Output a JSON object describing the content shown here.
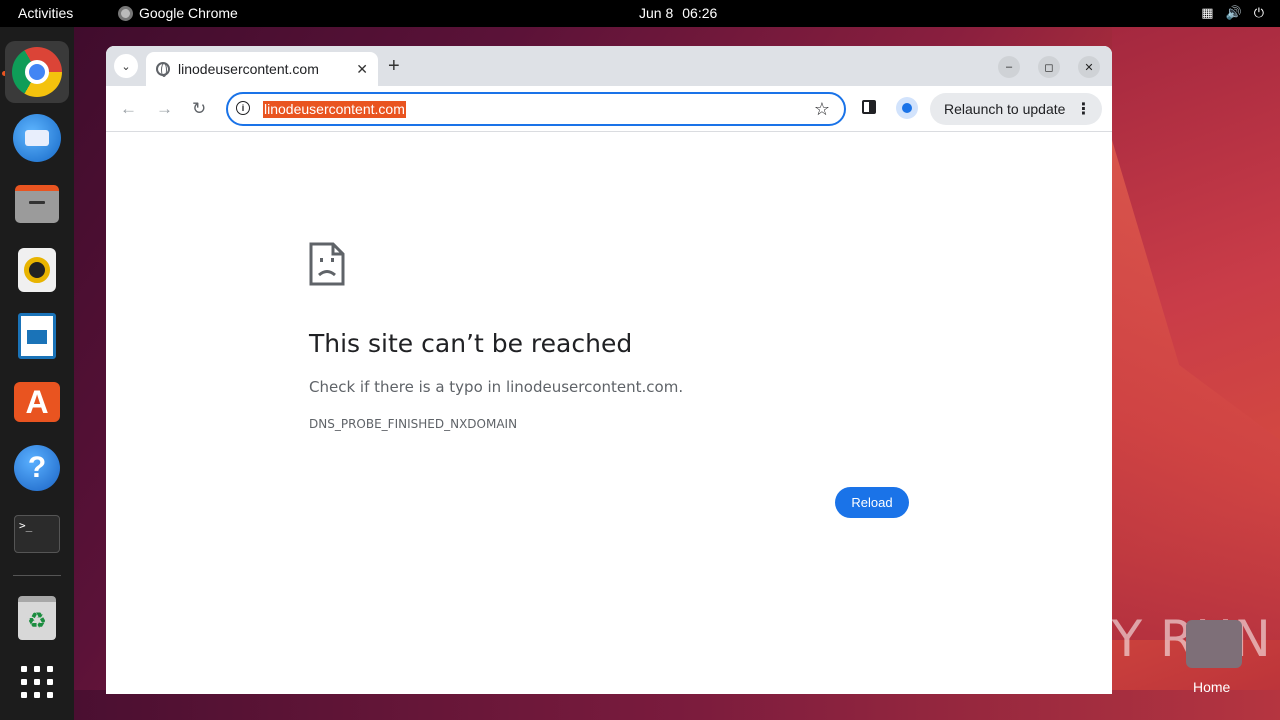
{
  "topbar": {
    "activities": "Activities",
    "app_name": "Google Chrome",
    "date": "Jun 8",
    "time": "06:26"
  },
  "dock": {
    "items": [
      "chrome",
      "thunderbird",
      "files",
      "rhythmbox",
      "writer",
      "app-center",
      "help",
      "terminal",
      "trash",
      "show-apps"
    ]
  },
  "browser": {
    "tab_title": "linodeusercontent.com",
    "url": "linodeusercontent.com",
    "relaunch_label": "Relaunch to update"
  },
  "error_page": {
    "title": "This site can’t be reached",
    "message": "Check if there is a typo in linodeusercontent.com.",
    "code": "DNS_PROBE_FINISHED_NXDOMAIN",
    "reload_label": "Reload"
  },
  "desktop": {
    "watermark": "ANY RUN",
    "home_label": "Home"
  },
  "colors": {
    "accent": "#1a73e8",
    "ubuntu_orange": "#e95420"
  }
}
